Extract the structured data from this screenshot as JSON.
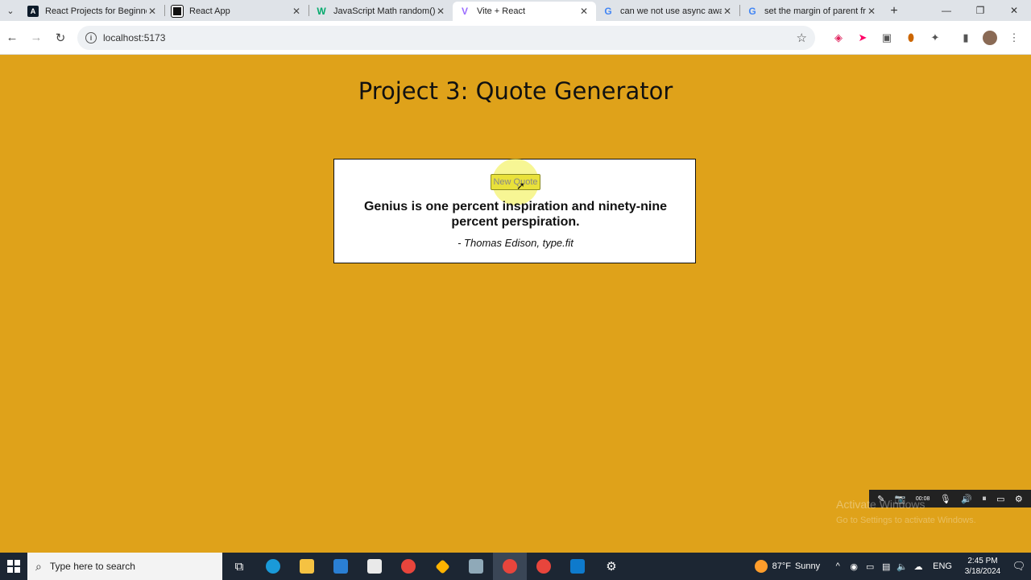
{
  "browser": {
    "tabs": [
      {
        "title": "React Projects for Beginners",
        "fav_letter": "A",
        "fav_color": "#0d1b2a",
        "active": false
      },
      {
        "title": "React App",
        "fav_letter": "",
        "fav_color": "#111111",
        "active": false
      },
      {
        "title": "JavaScript Math random()",
        "fav_letter": "W",
        "fav_color": "#04aa6d",
        "active": false
      },
      {
        "title": "Vite + React",
        "fav_letter": "V",
        "fav_color": "#9b6cff",
        "active": true
      },
      {
        "title": "can we not use async await",
        "fav_letter": "G",
        "fav_color": "#4285f4",
        "active": false
      },
      {
        "title": "set the margin of parent fr",
        "fav_letter": "G",
        "fav_color": "#4285f4",
        "active": false
      }
    ],
    "url": "localhost:5173"
  },
  "page": {
    "title": "Project 3: Quote Generator",
    "button_label": "New Quote",
    "quote": "Genius is one percent inspiration and ninety-nine percent perspiration.",
    "author": "- Thomas Edison, type.fit",
    "background_color": "#dfa21a"
  },
  "recorder": {
    "time": "00:08",
    "watermark": "Activate Windows",
    "watermark_sub": "Go to Settings to activate Windows."
  },
  "taskbar": {
    "search_placeholder": "Type here to search",
    "weather_temp": "87°F",
    "weather_desc": "Sunny",
    "language": "ENG",
    "time": "2:45 PM",
    "date": "3/18/2024"
  }
}
